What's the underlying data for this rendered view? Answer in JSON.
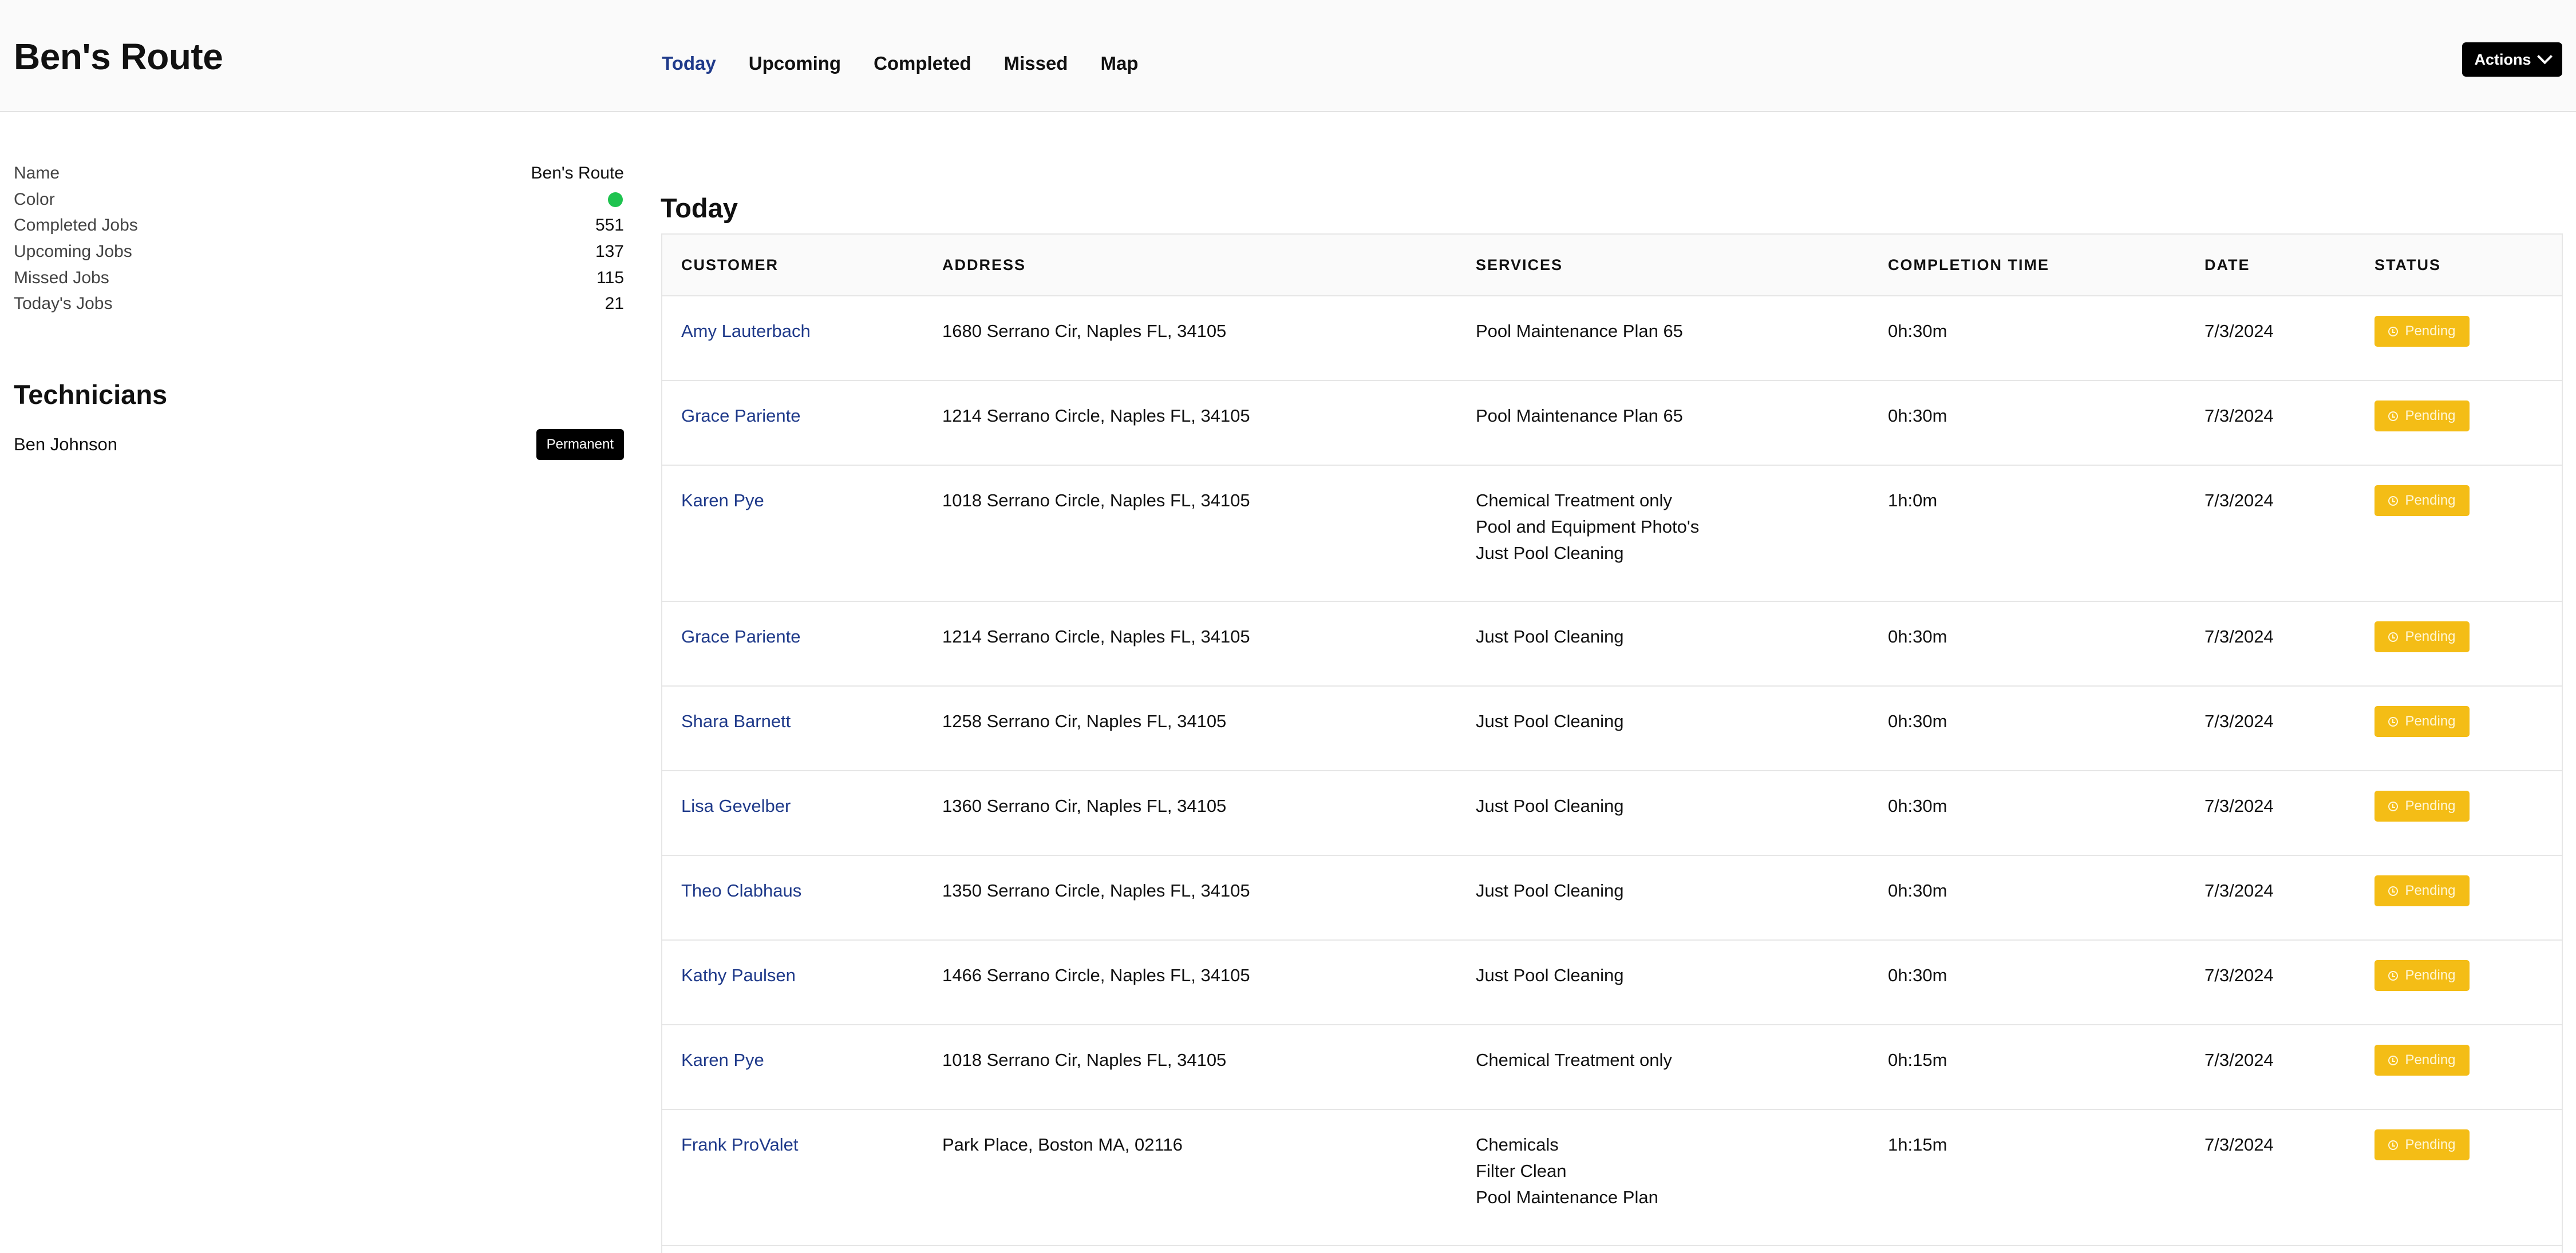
{
  "header": {
    "title": "Ben's Route",
    "tabs": [
      "Today",
      "Upcoming",
      "Completed",
      "Missed",
      "Map"
    ],
    "active_tab": "Today",
    "actions_label": "Actions"
  },
  "route_info": [
    {
      "label": "Name",
      "value": "Ben's Route"
    },
    {
      "label": "Color",
      "value": "",
      "color": "#1ec34f"
    },
    {
      "label": "Completed Jobs",
      "value": "551"
    },
    {
      "label": "Upcoming Jobs",
      "value": "137"
    },
    {
      "label": "Missed Jobs",
      "value": "115"
    },
    {
      "label": "Today's Jobs",
      "value": "21"
    }
  ],
  "technicians": {
    "title": "Technicians",
    "items": [
      {
        "name": "Ben Johnson",
        "badge": "Permanent"
      }
    ]
  },
  "main": {
    "title": "Today",
    "columns": [
      "CUSTOMER",
      "ADDRESS",
      "SERVICES",
      "COMPLETION TIME",
      "DATE",
      "STATUS"
    ],
    "rows": [
      {
        "customer": "Amy Lauterbach",
        "address": "1680 Serrano Cir, Naples FL, 34105",
        "services": [
          "Pool Maintenance Plan 65"
        ],
        "completion_time": "0h:30m",
        "date": "7/3/2024",
        "status": "Pending"
      },
      {
        "customer": "Grace Pariente",
        "address": "1214 Serrano Circle, Naples FL, 34105",
        "services": [
          "Pool Maintenance Plan 65"
        ],
        "completion_time": "0h:30m",
        "date": "7/3/2024",
        "status": "Pending"
      },
      {
        "customer": "Karen Pye",
        "address": "1018 Serrano Circle, Naples FL, 34105",
        "services": [
          "Chemical Treatment only",
          "Pool and Equipment Photo's",
          "Just Pool Cleaning"
        ],
        "completion_time": "1h:0m",
        "date": "7/3/2024",
        "status": "Pending"
      },
      {
        "customer": "Grace Pariente",
        "address": "1214 Serrano Circle, Naples FL, 34105",
        "services": [
          "Just Pool Cleaning"
        ],
        "completion_time": "0h:30m",
        "date": "7/3/2024",
        "status": "Pending"
      },
      {
        "customer": "Shara Barnett",
        "address": "1258 Serrano Cir, Naples FL, 34105",
        "services": [
          "Just Pool Cleaning"
        ],
        "completion_time": "0h:30m",
        "date": "7/3/2024",
        "status": "Pending"
      },
      {
        "customer": "Lisa Gevelber",
        "address": "1360 Serrano Cir, Naples FL, 34105",
        "services": [
          "Just Pool Cleaning"
        ],
        "completion_time": "0h:30m",
        "date": "7/3/2024",
        "status": "Pending"
      },
      {
        "customer": "Theo Clabhaus",
        "address": "1350 Serrano Circle, Naples FL, 34105",
        "services": [
          "Just Pool Cleaning"
        ],
        "completion_time": "0h:30m",
        "date": "7/3/2024",
        "status": "Pending"
      },
      {
        "customer": "Kathy Paulsen",
        "address": "1466 Serrano Circle, Naples FL, 34105",
        "services": [
          "Just Pool Cleaning"
        ],
        "completion_time": "0h:30m",
        "date": "7/3/2024",
        "status": "Pending"
      },
      {
        "customer": "Karen Pye",
        "address": "1018 Serrano Cir, Naples FL, 34105",
        "services": [
          "Chemical Treatment only"
        ],
        "completion_time": "0h:15m",
        "date": "7/3/2024",
        "status": "Pending"
      },
      {
        "customer": "Frank ProValet",
        "address": "Park Place, Boston MA, 02116",
        "services": [
          "Chemicals",
          "Filter Clean",
          "Pool Maintenance Plan"
        ],
        "completion_time": "1h:15m",
        "date": "7/3/2024",
        "status": "Pending"
      }
    ]
  },
  "colors": {
    "accent": "#1f3a8a",
    "pending": "#f4bd16",
    "route_color": "#1ec34f"
  }
}
